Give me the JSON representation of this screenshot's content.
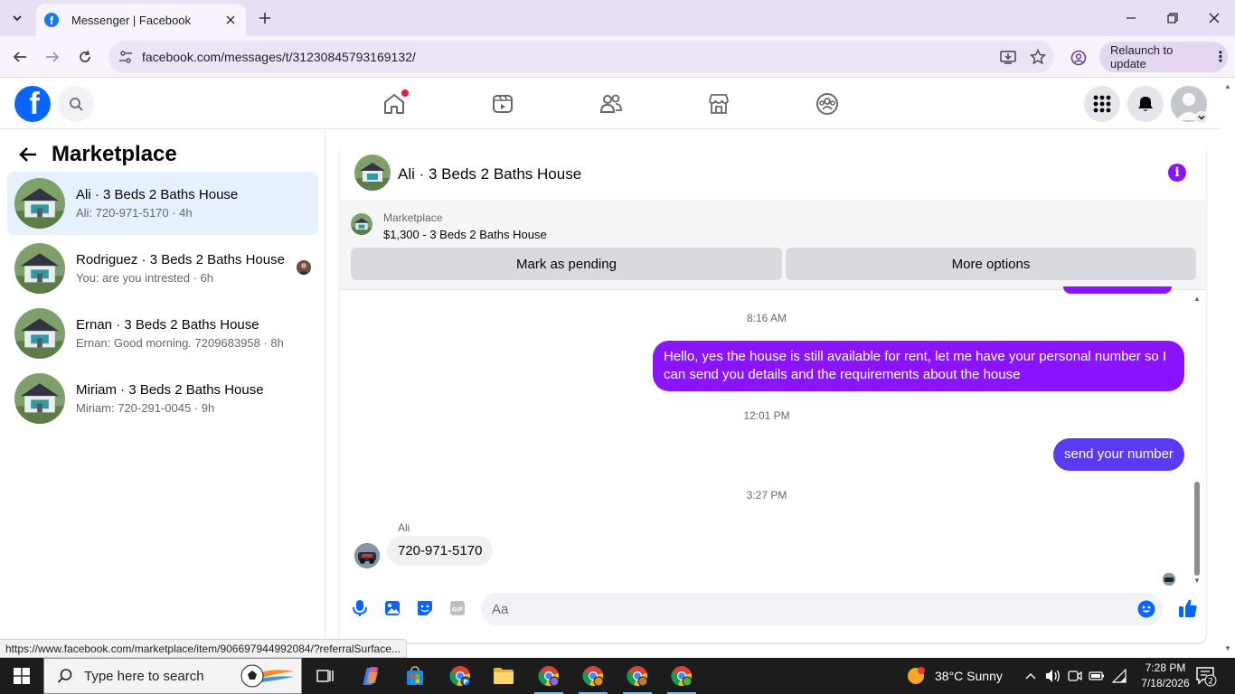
{
  "browser": {
    "tab_title": "Messenger | Facebook",
    "url": "facebook.com/messages/t/31230845793169132/",
    "relaunch_label": "Relaunch to update"
  },
  "facebook": {
    "logo_letter": "f"
  },
  "sidebar": {
    "title": "Marketplace",
    "conversations": [
      {
        "name": "Ali · 3 Beds 2 Baths House",
        "snippet": "Ali: 720-971-5170 · 4h",
        "active": true
      },
      {
        "name": "Rodriguez · 3 Beds 2 Baths House",
        "snippet": "You: are you intrested · 6h",
        "active": false
      },
      {
        "name": "Ernan · 3 Beds 2 Baths House",
        "snippet": "Ernan: Good morning. 7209683958 · 8h",
        "active": false
      },
      {
        "name": "Miriam · 3 Beds 2 Baths House",
        "snippet": "Miriam: 720-291-0045 · 9h",
        "active": false
      }
    ]
  },
  "chat": {
    "title": "Ali · 3 Beds 2 Baths House",
    "listing": {
      "label": "Marketplace",
      "price_title": "$1,300 - 3 Beds 2 Baths House",
      "mark_pending": "Mark as pending",
      "more_options": "More options"
    },
    "messages": [
      {
        "type": "timestamp",
        "text": "8:16 AM"
      },
      {
        "type": "outgoing",
        "text": "Hello, yes the house is still available for rent, let me have your personal number so I can send you details and the requirements about the house"
      },
      {
        "type": "timestamp",
        "text": "12:01 PM"
      },
      {
        "type": "outgoing",
        "text": "send your number"
      },
      {
        "type": "timestamp",
        "text": "3:27 PM"
      },
      {
        "type": "sender",
        "text": "Ali"
      },
      {
        "type": "incoming",
        "text": "720-971-5170"
      }
    ],
    "composer_placeholder": "Aa"
  },
  "status_url": "https://www.facebook.com/marketplace/item/906697944992084/?referralSurface...",
  "taskbar": {
    "search_placeholder": "Type here to search",
    "weather": "38°C  Sunny",
    "time": "7:28 PM",
    "date": "7/18/2026",
    "notification_count": "2"
  },
  "colors": {
    "messenger_purple": "#8a14ff",
    "messenger_blue": "#5b3af5",
    "facebook_blue": "#0866ff",
    "active_conversation": "#e7f0fd"
  }
}
